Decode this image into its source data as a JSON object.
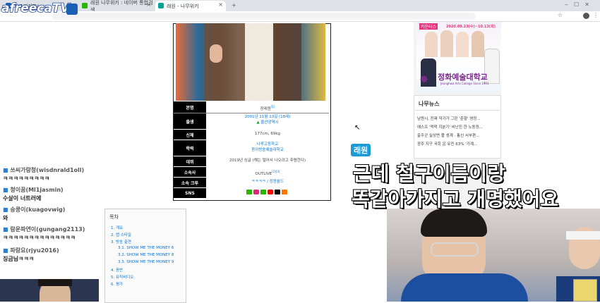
{
  "browser": {
    "tabs": [
      {
        "label": "아프리카TV",
        "active": false,
        "color": "#1a5fb4"
      },
      {
        "label": "래원 나무위키 : 네이버 통합검색",
        "active": false,
        "color": "#2db400"
      },
      {
        "label": "래원 - 나무위키",
        "active": true,
        "color": "#00a495"
      }
    ],
    "new_tab": "+"
  },
  "overlay": {
    "logo": "afreecaTV"
  },
  "infobox": {
    "rows": [
      {
        "label": "본명",
        "value": "장래원",
        "sup": "[1]"
      },
      {
        "label": "출생",
        "value": "2001년 11월 13일 (18세)",
        "value2": "울산광역시"
      },
      {
        "label": "신체",
        "value": "177cm, 69kg"
      },
      {
        "label": "학력",
        "value": "나루고등학교",
        "value2": "동아방송예술대학교"
      },
      {
        "label": "데뷔",
        "value": "2019년 싱글 (해는 떨어서 나오려고 후렴한다)"
      },
      {
        "label": "소속사",
        "value": "OUTLIVE",
        "sup": "[2][3]"
      },
      {
        "label": "소속 크루",
        "value": "ㅋㅋㅋㅋ / 정원월드"
      },
      {
        "label": "SNS",
        "value": ""
      }
    ]
  },
  "toc": {
    "title": "목차",
    "items": [
      "1. 개요",
      "2. 랩 스타일",
      "3. 방송 출연",
      "3.1. SHOW ME THE MONEY 6",
      "3.2. SHOW ME THE MONEY 8",
      "3.3. SHOW ME THE MONEY 9",
      "4. 음반",
      "5. 뮤직비디오",
      "6. 평가"
    ]
  },
  "ad": {
    "date": "2020.09.23(수)~10.13(화)",
    "school": "정화예술대학교",
    "school_en": "Jeonghwa Arts College Since 1991",
    "tag": "카운터스"
  },
  "news": {
    "title": "나무뉴스",
    "items": [
      "남원시, 진짜 작가가 그린 '춘향' 영정...",
      "에스프 '먹먹 지분기' 비난진 한 노동정...",
      "출주군 실상면 플 생계 · 통신 서부편...",
      "광주 지구 국회 운 유진 63% '가계..."
    ]
  },
  "chat": [
    {
      "nick": "쓰씨가랑청(wisdnrald1oll)",
      "msg": "ㅋㅋㅋㅋㅋㅋㅋㅋㅋ"
    },
    {
      "nick": "청이꿈(Ml1jasmin)",
      "msg": "수살이 너트러에"
    },
    {
      "nick": "숭쿵이(kuagovwig)",
      "msg": "와"
    },
    {
      "nick": "람운파연이(gungang2113)",
      "msg": "ㅋㅋㅋㅋㅋㅋㅋㅋㅋㅋㅋㅋㅋㅋ"
    },
    {
      "nick": "파랑요(rjyu2016)",
      "msg": "징금님ㅋㅋㅋ"
    }
  ],
  "stream": {
    "speaker": "래원",
    "subtitle_line1": "근데 철구이름이랑",
    "subtitle_line2": "똑같아가지고 개명했어요"
  }
}
